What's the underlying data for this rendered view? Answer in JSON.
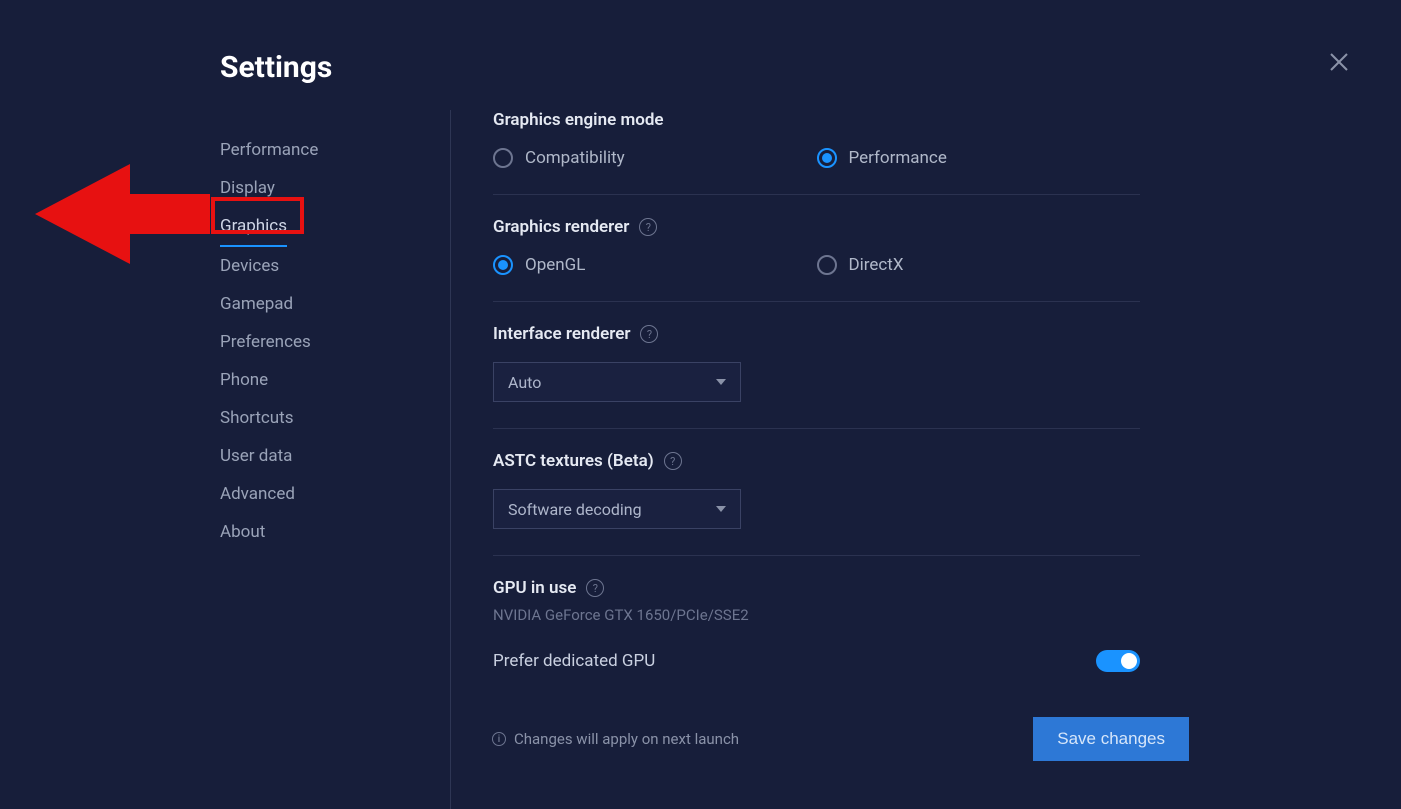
{
  "header": {
    "title": "Settings"
  },
  "sidebar": {
    "items": [
      {
        "label": "Performance"
      },
      {
        "label": "Display"
      },
      {
        "label": "Graphics"
      },
      {
        "label": "Devices"
      },
      {
        "label": "Gamepad"
      },
      {
        "label": "Preferences"
      },
      {
        "label": "Phone"
      },
      {
        "label": "Shortcuts"
      },
      {
        "label": "User data"
      },
      {
        "label": "Advanced"
      },
      {
        "label": "About"
      }
    ]
  },
  "graphics": {
    "engine_mode": {
      "title": "Graphics engine mode",
      "options": {
        "compat": "Compatibility",
        "perf": "Performance"
      }
    },
    "renderer": {
      "title": "Graphics renderer",
      "options": {
        "opengl": "OpenGL",
        "directx": "DirectX"
      }
    },
    "interface_renderer": {
      "title": "Interface renderer",
      "value": "Auto"
    },
    "astc": {
      "title": "ASTC textures (Beta)",
      "value": "Software decoding"
    },
    "gpu": {
      "title": "GPU in use",
      "detail": "NVIDIA GeForce GTX 1650/PCIe/SSE2",
      "prefer_label": "Prefer dedicated GPU"
    }
  },
  "footer": {
    "note": "Changes will apply on next launch",
    "save": "Save changes"
  }
}
